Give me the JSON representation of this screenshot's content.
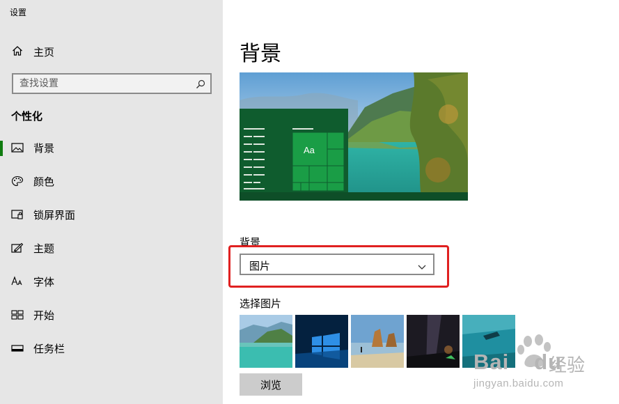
{
  "app": {
    "title": "设置"
  },
  "sidebar": {
    "home": {
      "label": "主页",
      "icon": "home-icon"
    },
    "search": {
      "placeholder": "查找设置",
      "icon": "search-icon"
    },
    "section_heading": "个性化",
    "items": [
      {
        "label": "背景",
        "icon": "image-icon",
        "active": true
      },
      {
        "label": "颜色",
        "icon": "palette-icon",
        "active": false
      },
      {
        "label": "锁屏界面",
        "icon": "lock-screen-icon",
        "active": false
      },
      {
        "label": "主题",
        "icon": "theme-icon",
        "active": false
      },
      {
        "label": "字体",
        "icon": "font-icon",
        "active": false
      },
      {
        "label": "开始",
        "icon": "start-icon",
        "active": false
      },
      {
        "label": "任务栏",
        "icon": "taskbar-icon",
        "active": false
      }
    ]
  },
  "main": {
    "title": "背景",
    "preview": {
      "tile_text": "Aa"
    },
    "background_field": {
      "label": "背景",
      "value": "图片"
    },
    "choose_picture": {
      "label": "选择图片",
      "thumbnail_count": 5
    },
    "browse_label": "浏览"
  },
  "watermark": {
    "brand": "Bai",
    "brand2": "du",
    "brand_suffix": "经验",
    "url": "jingyan.baidu.com"
  },
  "colors": {
    "accent": "#107c10",
    "sidebar_bg": "#e6e6e6",
    "highlight": "#e02020",
    "tile_green": "#107c10"
  }
}
